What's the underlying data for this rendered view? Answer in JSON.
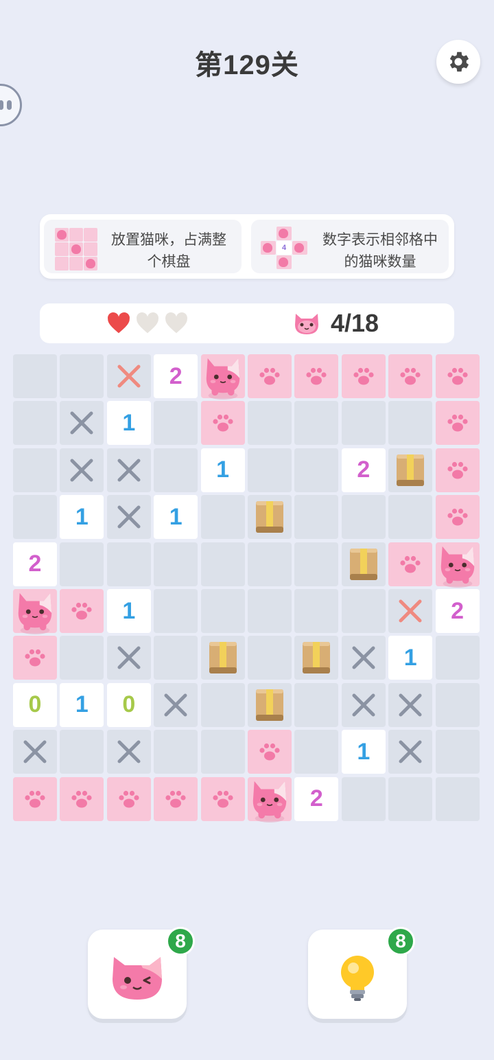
{
  "header": {
    "title": "第129关"
  },
  "rules": {
    "rule1": "放置猫咪，占满整个棋盘",
    "rule2": "数字表示相邻格中的猫咪数量",
    "rule2_example_number": "4"
  },
  "status": {
    "lives_total": 3,
    "lives_remaining": 1,
    "cat_progress": "4/18"
  },
  "board": {
    "size": 10,
    "legend": {
      "E": "empty",
      "P": "paw",
      "C": "cat",
      "X": "cross-gray",
      "R": "cross-red",
      "B": "box",
      "N": "number"
    },
    "rows": [
      [
        "E",
        "E",
        "R",
        "N2",
        "C",
        "P",
        "P",
        "P",
        "P",
        "P"
      ],
      [
        "E",
        "X",
        "N1",
        "E",
        "P",
        "E",
        "E",
        "E",
        "E",
        "P"
      ],
      [
        "E",
        "X",
        "X",
        "E",
        "N1",
        "E",
        "E",
        "N2",
        "B",
        "P"
      ],
      [
        "E",
        "N1",
        "X",
        "N1",
        "E",
        "B",
        "E",
        "E",
        "E",
        "P"
      ],
      [
        "N2",
        "E",
        "E",
        "E",
        "E",
        "E",
        "E",
        "B",
        "P",
        "C"
      ],
      [
        "C",
        "P",
        "N1",
        "E",
        "E",
        "E",
        "E",
        "E",
        "R",
        "N2"
      ],
      [
        "P",
        "E",
        "X",
        "E",
        "B",
        "E",
        "B",
        "X",
        "N1",
        "E"
      ],
      [
        "N0",
        "N1",
        "N0",
        "X",
        "E",
        "B",
        "E",
        "X",
        "X",
        "E"
      ],
      [
        "X",
        "E",
        "X",
        "E",
        "E",
        "P",
        "E",
        "N1",
        "X",
        "E"
      ],
      [
        "P",
        "P",
        "P",
        "P",
        "P",
        "C",
        "N2",
        "E",
        "E",
        "E"
      ]
    ],
    "number_colors": {
      "0": "#a6c94a",
      "1": "#34a0e3",
      "2": "#d25fcc"
    }
  },
  "tools": {
    "cat_hint_count": "8",
    "bulb_hint_count": "8"
  },
  "colors": {
    "background": "#e9ecf7",
    "paw_cell": "#f9c6d8",
    "empty_cell": "#dce1ea",
    "heart_full": "#ec4a4a",
    "heart_empty": "#e7e3de",
    "badge": "#2ea84a"
  }
}
